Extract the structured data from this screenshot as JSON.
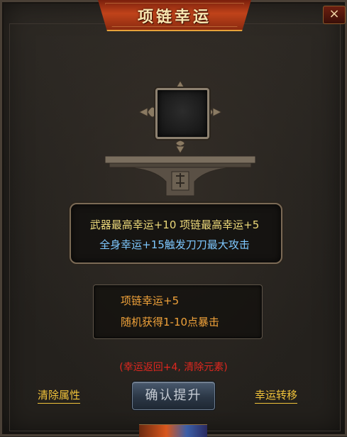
{
  "window": {
    "title": "项链幸运",
    "close_label": "×"
  },
  "info": {
    "line1": "武器最高幸运+10 项链最高幸运+5",
    "line2": "全身幸运+15触发刀刀最大攻击"
  },
  "result": {
    "line1": "项链幸运+5",
    "line2": "随机获得1-10点暴击"
  },
  "note": "(幸运返回+4, 清除元素)",
  "actions": {
    "clear_label": "清除属性",
    "confirm_label": "确认提升",
    "transfer_label": "幸运转移"
  },
  "colors": {
    "title": "#f8e6b0",
    "info_line1": "#ecd97a",
    "info_line2": "#7ec8ff",
    "result_text": "#f0a23a",
    "note_text": "#e0271f",
    "link_text": "#f0c23a"
  }
}
